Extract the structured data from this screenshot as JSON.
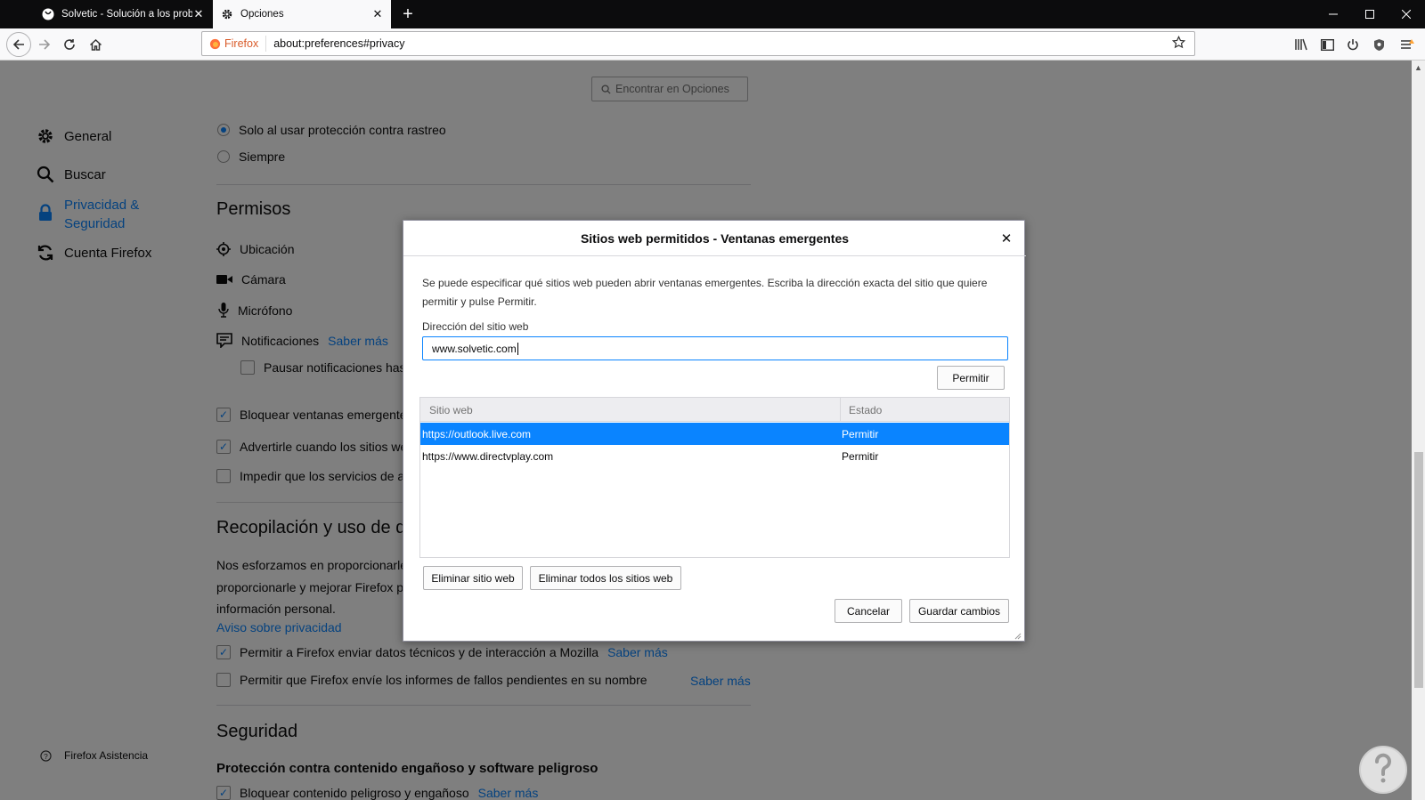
{
  "tabs": [
    {
      "title": "Solvetic - Solución a los proble",
      "icon": "globe-icon"
    },
    {
      "title": "Opciones",
      "icon": "gear-icon"
    }
  ],
  "urlbar": {
    "identity": "Firefox",
    "url": "about:preferences#privacy"
  },
  "find": {
    "placeholder": "Encontrar en Opciones"
  },
  "sidebar": {
    "items": [
      {
        "label": "General",
        "icon": "gear-icon"
      },
      {
        "label": "Buscar",
        "icon": "search-icon"
      },
      {
        "label_line1": "Privacidad &",
        "label_line2": "Seguridad",
        "icon": "lock-icon",
        "selected": true
      },
      {
        "label": "Cuenta Firefox",
        "icon": "sync-icon"
      }
    ],
    "support": "Firefox Asistencia"
  },
  "main": {
    "radio1": "Solo al usar protección contra rastreo",
    "radio2": "Siempre",
    "permisos_heading": "Permisos",
    "perm_ubicacion": "Ubicación",
    "perm_camara": "Cámara",
    "perm_microfono": "Micrófono",
    "perm_notificaciones": "Notificaciones",
    "saber_mas": "Saber más",
    "pausar": "Pausar notificaciones hasta",
    "bloquear_ventanas": "Bloquear ventanas emergentes",
    "advertir": "Advertirle cuando los sitios wel",
    "impedir": "Impedir que los servicios de ac",
    "recop_heading": "Recopilación y uso de dat",
    "recop_p1": "Nos esforzamos en proporcionarle",
    "recop_p2": "proporcionarle y mejorar Firefox pa",
    "recop_p3": "información personal.",
    "aviso": "Aviso sobre privacidad",
    "permitir_datos": "Permitir a Firefox enviar datos técnicos y de interacción a Mozilla",
    "permitir_fallos": "Permitir que Firefox envíe los informes de fallos pendientes en su nombre",
    "seguridad_heading": "Seguridad",
    "proteccion_heading": "Protección contra contenido engañoso y software peligroso",
    "bloquear_contenido": "Bloquear contenido peligroso y engañoso"
  },
  "dialog": {
    "title": "Sitios web permitidos - Ventanas emergentes",
    "description": "Se puede especificar qué sitios web pueden abrir ventanas emergentes. Escriba la dirección exacta del sitio que quiere permitir y pulse Permitir.",
    "address_label": "Dirección del sitio web",
    "address_value": "www.solvetic.com",
    "allow_button": "Permitir",
    "col_site": "Sitio web",
    "col_status": "Estado",
    "rows": [
      {
        "site": "https://outlook.live.com",
        "status": "Permitir"
      },
      {
        "site": "https://www.directvplay.com",
        "status": "Permitir"
      }
    ],
    "remove_button": "Eliminar sitio web",
    "remove_all_button": "Eliminar todos los sitios web",
    "cancel_button": "Cancelar",
    "save_button": "Guardar cambios"
  },
  "colors": {
    "accent": "#0a84ff",
    "tabbar": "#0c0c0d"
  }
}
